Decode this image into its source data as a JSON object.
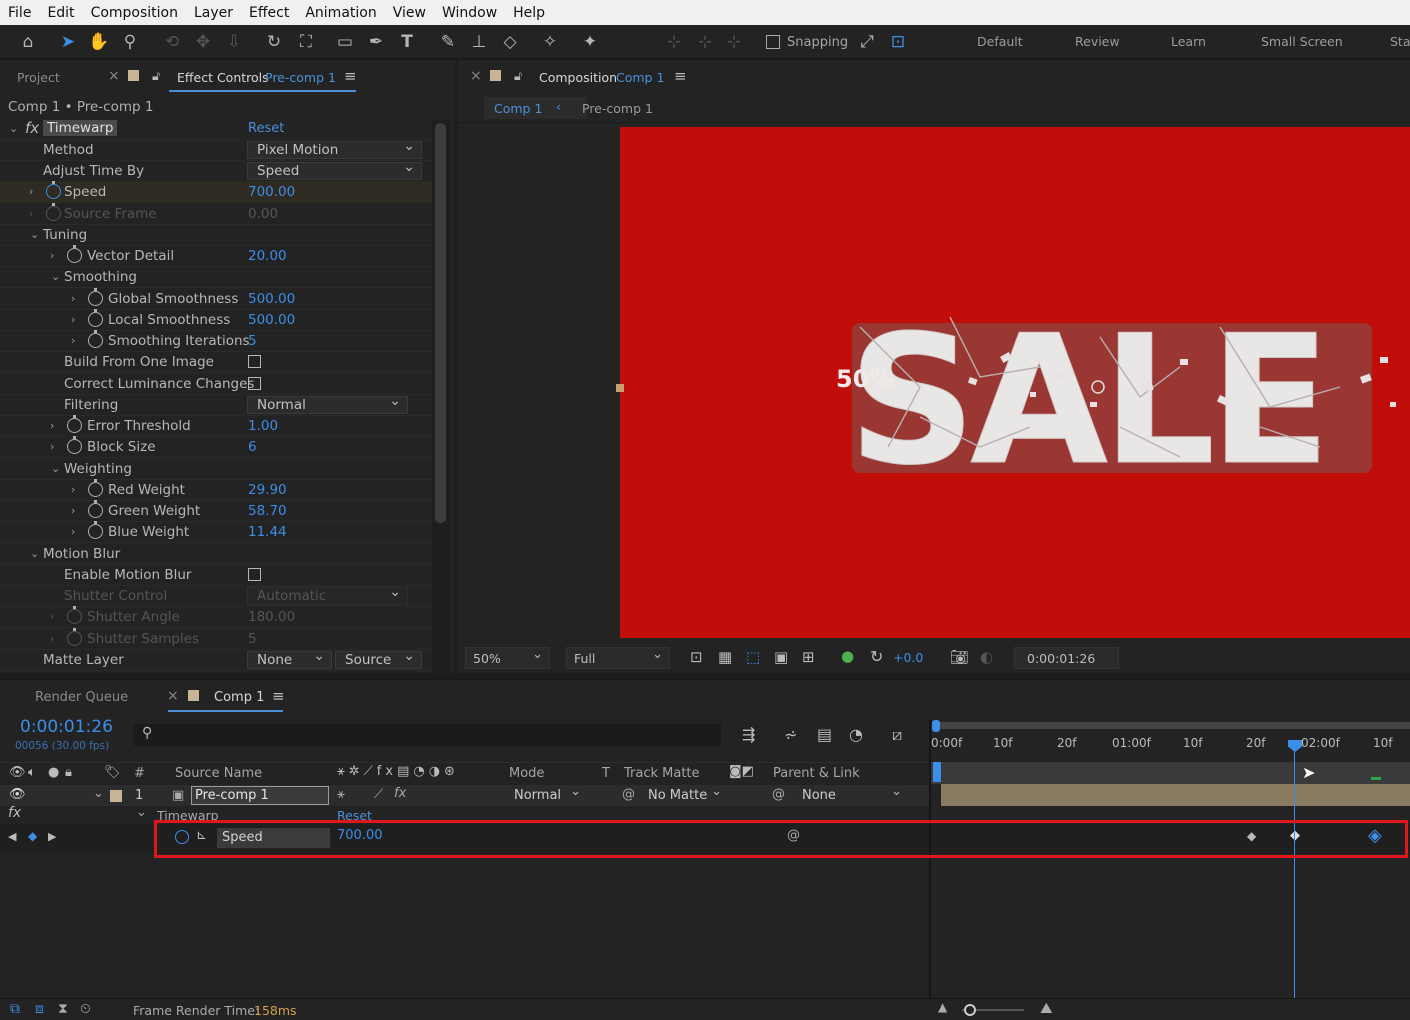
{
  "menu": [
    "File",
    "Edit",
    "Composition",
    "Layer",
    "Effect",
    "Animation",
    "View",
    "Window",
    "Help"
  ],
  "toolbar": {
    "snapping_label": "Snapping",
    "workspaces": [
      "Default",
      "Review",
      "Learn",
      "Small Screen",
      "Sta"
    ]
  },
  "left_panel": {
    "project_tab": "Project",
    "effect_tab_prefix": "Effect Controls",
    "effect_tab_target": "Pre-comp 1",
    "breadcrumb": "Comp 1 • Pre-comp 1",
    "effect_name": "Timewarp",
    "reset": "Reset",
    "rows": {
      "method": {
        "label": "Method",
        "value": "Pixel Motion"
      },
      "adjust": {
        "label": "Adjust Time By",
        "value": "Speed"
      },
      "speed": {
        "label": "Speed",
        "value": "700.00"
      },
      "source_frame": {
        "label": "Source Frame",
        "value": "0.00"
      },
      "tuning": {
        "label": "Tuning"
      },
      "vector_detail": {
        "label": "Vector Detail",
        "value": "20.00"
      },
      "smoothing": {
        "label": "Smoothing"
      },
      "global_smooth": {
        "label": "Global Smoothness",
        "value": "500.00"
      },
      "local_smooth": {
        "label": "Local Smoothness",
        "value": "500.00"
      },
      "smooth_iter": {
        "label": "Smoothing Iterations",
        "value": "5"
      },
      "build_one": {
        "label": "Build From One Image"
      },
      "correct_lum": {
        "label": "Correct Luminance Changes"
      },
      "filtering": {
        "label": "Filtering",
        "value": "Normal"
      },
      "error_thresh": {
        "label": "Error Threshold",
        "value": "1.00"
      },
      "block_size": {
        "label": "Block Size",
        "value": "6"
      },
      "weighting": {
        "label": "Weighting"
      },
      "red_weight": {
        "label": "Red Weight",
        "value": "29.90"
      },
      "green_weight": {
        "label": "Green Weight",
        "value": "58.70"
      },
      "blue_weight": {
        "label": "Blue Weight",
        "value": "11.44"
      },
      "motion_blur": {
        "label": "Motion Blur"
      },
      "enable_mb": {
        "label": "Enable Motion Blur"
      },
      "shutter_control": {
        "label": "Shutter Control",
        "value": "Automatic"
      },
      "shutter_angle": {
        "label": "Shutter Angle",
        "value": "180.00"
      },
      "shutter_samples": {
        "label": "Shutter Samples",
        "value": "5"
      },
      "matte_layer": {
        "label": "Matte Layer",
        "value": "None",
        "value2": "Source"
      }
    }
  },
  "comp_panel": {
    "tab_prefix": "Composition",
    "tab_target": "Comp 1",
    "crumb1": "Comp 1",
    "crumb2": "Pre-comp 1",
    "zoom": "50%",
    "resolution": "Full",
    "exposure": "+0.0",
    "timecode": "0:00:01:26",
    "art_big": "SALE",
    "art_small": "50%"
  },
  "timeline": {
    "render_queue_tab": "Render Queue",
    "comp_tab": "Comp 1",
    "timecode": "0:00:01:26",
    "frame_info": "00056 (30.00 fps)",
    "ruler": [
      "0:00f",
      "10f",
      "20f",
      "01:00f",
      "10f",
      "20f",
      "02:00f",
      "10f"
    ],
    "headers": {
      "num": "#",
      "source": "Source Name",
      "mode": "Mode",
      "t": "T",
      "track_matte": "Track Matte",
      "parent": "Parent & Link"
    },
    "layer": {
      "index": "1",
      "name": "Pre-comp 1",
      "mode": "Normal",
      "matte": "No Matte",
      "parent": "None"
    },
    "effect_group": "Timewarp",
    "effect_reset": "Reset",
    "prop_name": "Speed",
    "prop_value": "700.00",
    "footer_label": "Frame Render Time:",
    "footer_value": "158ms"
  }
}
